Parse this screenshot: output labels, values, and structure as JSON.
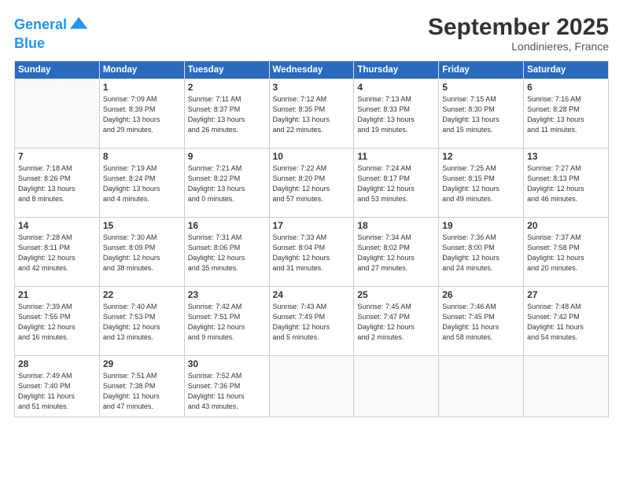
{
  "logo": {
    "text1": "General",
    "text2": "Blue"
  },
  "title": "September 2025",
  "location": "Londinieres, France",
  "days_header": [
    "Sunday",
    "Monday",
    "Tuesday",
    "Wednesday",
    "Thursday",
    "Friday",
    "Saturday"
  ],
  "weeks": [
    [
      {
        "day": "",
        "info": ""
      },
      {
        "day": "1",
        "info": "Sunrise: 7:09 AM\nSunset: 8:39 PM\nDaylight: 13 hours\nand 29 minutes."
      },
      {
        "day": "2",
        "info": "Sunrise: 7:11 AM\nSunset: 8:37 PM\nDaylight: 13 hours\nand 26 minutes."
      },
      {
        "day": "3",
        "info": "Sunrise: 7:12 AM\nSunset: 8:35 PM\nDaylight: 13 hours\nand 22 minutes."
      },
      {
        "day": "4",
        "info": "Sunrise: 7:13 AM\nSunset: 8:33 PM\nDaylight: 13 hours\nand 19 minutes."
      },
      {
        "day": "5",
        "info": "Sunrise: 7:15 AM\nSunset: 8:30 PM\nDaylight: 13 hours\nand 15 minutes."
      },
      {
        "day": "6",
        "info": "Sunrise: 7:16 AM\nSunset: 8:28 PM\nDaylight: 13 hours\nand 11 minutes."
      }
    ],
    [
      {
        "day": "7",
        "info": "Sunrise: 7:18 AM\nSunset: 8:26 PM\nDaylight: 13 hours\nand 8 minutes."
      },
      {
        "day": "8",
        "info": "Sunrise: 7:19 AM\nSunset: 8:24 PM\nDaylight: 13 hours\nand 4 minutes."
      },
      {
        "day": "9",
        "info": "Sunrise: 7:21 AM\nSunset: 8:22 PM\nDaylight: 13 hours\nand 0 minutes."
      },
      {
        "day": "10",
        "info": "Sunrise: 7:22 AM\nSunset: 8:20 PM\nDaylight: 12 hours\nand 57 minutes."
      },
      {
        "day": "11",
        "info": "Sunrise: 7:24 AM\nSunset: 8:17 PM\nDaylight: 12 hours\nand 53 minutes."
      },
      {
        "day": "12",
        "info": "Sunrise: 7:25 AM\nSunset: 8:15 PM\nDaylight: 12 hours\nand 49 minutes."
      },
      {
        "day": "13",
        "info": "Sunrise: 7:27 AM\nSunset: 8:13 PM\nDaylight: 12 hours\nand 46 minutes."
      }
    ],
    [
      {
        "day": "14",
        "info": "Sunrise: 7:28 AM\nSunset: 8:11 PM\nDaylight: 12 hours\nand 42 minutes."
      },
      {
        "day": "15",
        "info": "Sunrise: 7:30 AM\nSunset: 8:09 PM\nDaylight: 12 hours\nand 38 minutes."
      },
      {
        "day": "16",
        "info": "Sunrise: 7:31 AM\nSunset: 8:06 PM\nDaylight: 12 hours\nand 35 minutes."
      },
      {
        "day": "17",
        "info": "Sunrise: 7:33 AM\nSunset: 8:04 PM\nDaylight: 12 hours\nand 31 minutes."
      },
      {
        "day": "18",
        "info": "Sunrise: 7:34 AM\nSunset: 8:02 PM\nDaylight: 12 hours\nand 27 minutes."
      },
      {
        "day": "19",
        "info": "Sunrise: 7:36 AM\nSunset: 8:00 PM\nDaylight: 12 hours\nand 24 minutes."
      },
      {
        "day": "20",
        "info": "Sunrise: 7:37 AM\nSunset: 7:58 PM\nDaylight: 12 hours\nand 20 minutes."
      }
    ],
    [
      {
        "day": "21",
        "info": "Sunrise: 7:39 AM\nSunset: 7:55 PM\nDaylight: 12 hours\nand 16 minutes."
      },
      {
        "day": "22",
        "info": "Sunrise: 7:40 AM\nSunset: 7:53 PM\nDaylight: 12 hours\nand 13 minutes."
      },
      {
        "day": "23",
        "info": "Sunrise: 7:42 AM\nSunset: 7:51 PM\nDaylight: 12 hours\nand 9 minutes."
      },
      {
        "day": "24",
        "info": "Sunrise: 7:43 AM\nSunset: 7:49 PM\nDaylight: 12 hours\nand 5 minutes."
      },
      {
        "day": "25",
        "info": "Sunrise: 7:45 AM\nSunset: 7:47 PM\nDaylight: 12 hours\nand 2 minutes."
      },
      {
        "day": "26",
        "info": "Sunrise: 7:46 AM\nSunset: 7:45 PM\nDaylight: 11 hours\nand 58 minutes."
      },
      {
        "day": "27",
        "info": "Sunrise: 7:48 AM\nSunset: 7:42 PM\nDaylight: 11 hours\nand 54 minutes."
      }
    ],
    [
      {
        "day": "28",
        "info": "Sunrise: 7:49 AM\nSunset: 7:40 PM\nDaylight: 11 hours\nand 51 minutes."
      },
      {
        "day": "29",
        "info": "Sunrise: 7:51 AM\nSunset: 7:38 PM\nDaylight: 11 hours\nand 47 minutes."
      },
      {
        "day": "30",
        "info": "Sunrise: 7:52 AM\nSunset: 7:36 PM\nDaylight: 11 hours\nand 43 minutes."
      },
      {
        "day": "",
        "info": ""
      },
      {
        "day": "",
        "info": ""
      },
      {
        "day": "",
        "info": ""
      },
      {
        "day": "",
        "info": ""
      }
    ]
  ]
}
